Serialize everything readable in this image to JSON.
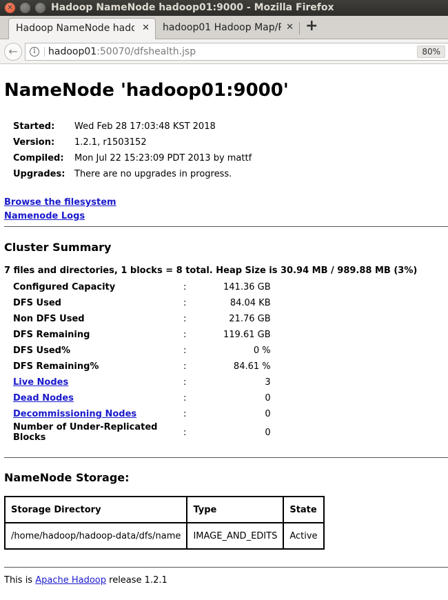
{
  "window": {
    "title": "Hadoop NameNode hadoop01:9000 - Mozilla Firefox"
  },
  "tabs": [
    {
      "label": "Hadoop NameNode hado",
      "active": true
    },
    {
      "label": "hadoop01 Hadoop Map/R",
      "active": false
    }
  ],
  "navbar": {
    "url_host": "hadoop01",
    "url_rest": ":50070/dfshealth.jsp",
    "zoom": "80%"
  },
  "page": {
    "heading": "NameNode 'hadoop01:9000'",
    "info": [
      {
        "key": "Started:",
        "value": "Wed Feb 28 17:03:48 KST 2018"
      },
      {
        "key": "Version:",
        "value": "1.2.1, r1503152"
      },
      {
        "key": "Compiled:",
        "value": "Mon Jul 22 15:23:09 PDT 2013 by mattf"
      },
      {
        "key": "Upgrades:",
        "value": "There are no upgrades in progress."
      }
    ],
    "links": {
      "browse": "Browse the filesystem",
      "logs": "Namenode Logs"
    },
    "cluster_summary": {
      "heading": "Cluster Summary",
      "summary": "7 files and directories, 1 blocks = 8 total. Heap Size is 30.94 MB / 989.88 MB (3%)",
      "rows": [
        {
          "key": "Configured Capacity",
          "sep": ":",
          "value": "141.36 GB"
        },
        {
          "key": "DFS Used",
          "sep": ":",
          "value": "84.04 KB"
        },
        {
          "key": "Non DFS Used",
          "sep": ":",
          "value": "21.76 GB"
        },
        {
          "key": "DFS Remaining",
          "sep": ":",
          "value": "119.61 GB"
        },
        {
          "key": "DFS Used%",
          "sep": ":",
          "value": "0 %"
        },
        {
          "key": "DFS Remaining%",
          "sep": ":",
          "value": "84.61 %"
        },
        {
          "key": "Live Nodes",
          "sep": ":",
          "value": "3"
        },
        {
          "key": "Dead Nodes",
          "sep": ":",
          "value": "0"
        },
        {
          "key": "Decommissioning Nodes",
          "sep": ":",
          "value": "0"
        },
        {
          "key": "Number of Under-Replicated Blocks",
          "sep": ":",
          "value": "0"
        }
      ]
    },
    "storage": {
      "heading": "NameNode Storage:",
      "headers": [
        "Storage Directory",
        "Type",
        "State"
      ],
      "row": [
        "/home/hadoop/hadoop-data/dfs/name",
        "IMAGE_AND_EDITS",
        "Active"
      ]
    },
    "footer": {
      "prefix": "This is ",
      "link": "Apache Hadoop",
      "suffix": " release 1.2.1"
    }
  }
}
